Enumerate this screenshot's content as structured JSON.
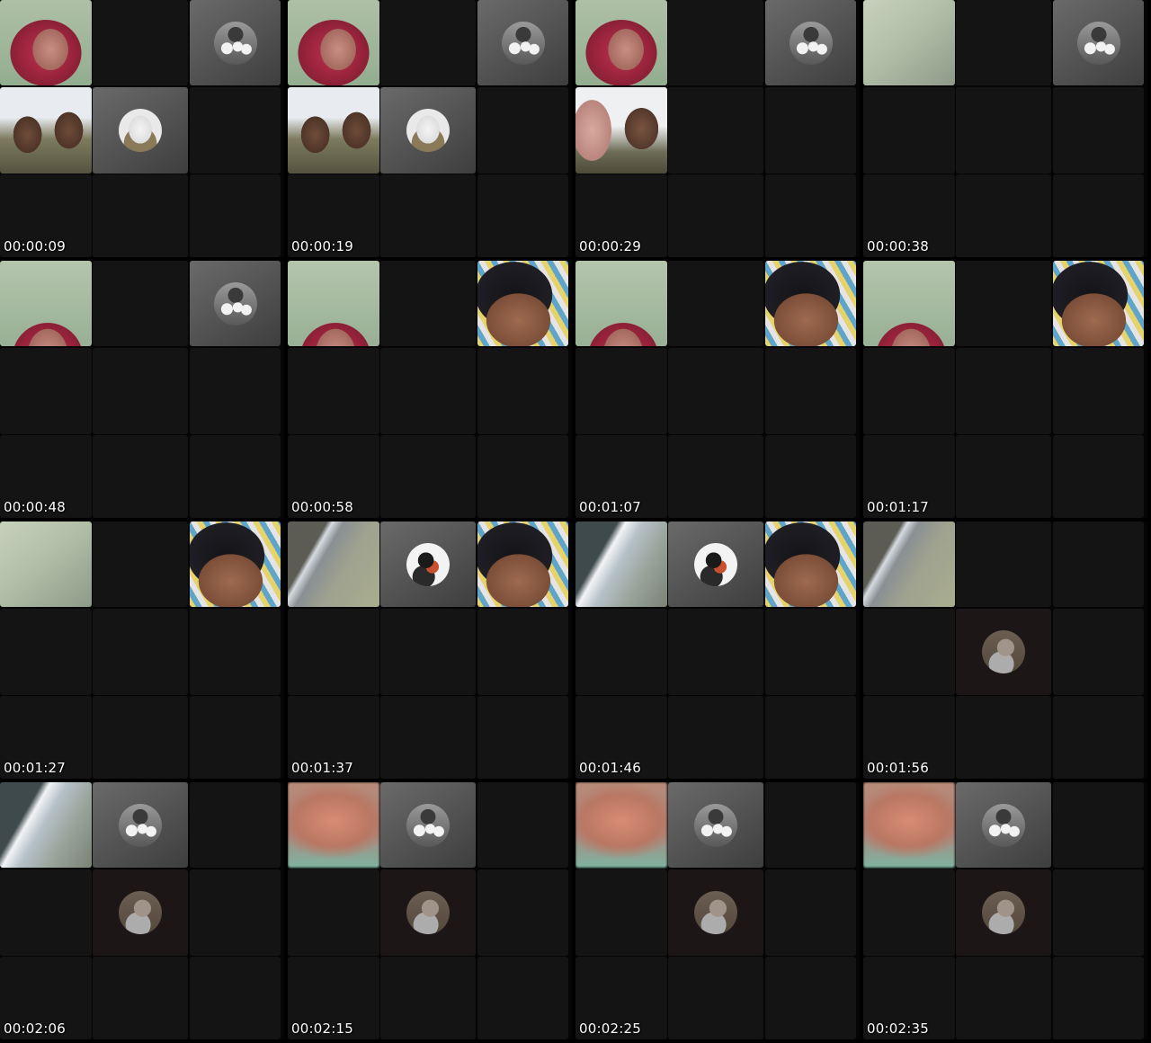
{
  "contact_sheet": {
    "frames": [
      {
        "timestamp": "00:00:09"
      },
      {
        "timestamp": "00:00:19"
      },
      {
        "timestamp": "00:00:29"
      },
      {
        "timestamp": "00:00:38"
      },
      {
        "timestamp": "00:00:48"
      },
      {
        "timestamp": "00:00:58"
      },
      {
        "timestamp": "00:01:07"
      },
      {
        "timestamp": "00:01:17"
      },
      {
        "timestamp": "00:01:27"
      },
      {
        "timestamp": "00:01:37"
      },
      {
        "timestamp": "00:01:46"
      },
      {
        "timestamp": "00:01:56"
      },
      {
        "timestamp": "00:02:06"
      },
      {
        "timestamp": "00:02:15"
      },
      {
        "timestamp": "00:02:25"
      },
      {
        "timestamp": "00:02:35"
      }
    ]
  },
  "tile_content": {
    "girl": "video-tile-girl-face",
    "soldiers": "video-tile-soldiers",
    "avatar_group": "avatar-group-icon",
    "avatar_mask": "avatar-mask-icon",
    "avatar_phone": "avatar-phone-icon",
    "avatar_portrait": "avatar-portrait-icon"
  }
}
